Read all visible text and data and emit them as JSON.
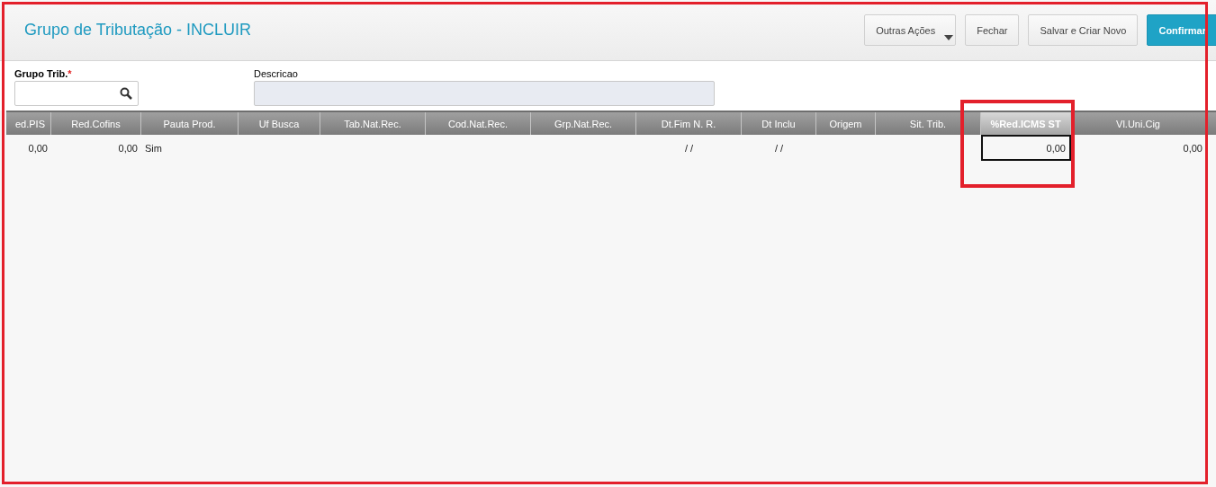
{
  "title": "Grupo de Tributação - INCLUIR",
  "actions": [
    {
      "label": "Outras Ações",
      "kind": "menu"
    },
    {
      "label": "Fechar",
      "kind": "plain"
    },
    {
      "label": "Salvar e Criar Novo",
      "kind": "plain"
    },
    {
      "label": "Confirmar",
      "kind": "primary"
    }
  ],
  "fields": [
    {
      "label": "Grupo Trib.",
      "required_mark": "*",
      "kind": "search"
    },
    {
      "label": "Descricao",
      "kind": "readonly"
    }
  ],
  "table": {
    "columns": [
      {
        "label": "ed.PIS",
        "selected": false
      },
      {
        "label": "Red.Cofins",
        "selected": false
      },
      {
        "label": "Pauta Prod.",
        "selected": false
      },
      {
        "label": "Uf Busca",
        "selected": false
      },
      {
        "label": "Tab.Nat.Rec.",
        "selected": false
      },
      {
        "label": "Cod.Nat.Rec.",
        "selected": false
      },
      {
        "label": "Grp.Nat.Rec.",
        "selected": false
      },
      {
        "label": "Dt.Fim N. R.",
        "selected": false
      },
      {
        "label": "Dt Inclu",
        "selected": false
      },
      {
        "label": "Origem",
        "selected": false
      },
      {
        "label": "Sit. Trib.",
        "selected": false
      },
      {
        "label": "%Red.ICMS ST",
        "selected": true
      },
      {
        "label": "Vl.Uni.Cig",
        "selected": false
      }
    ],
    "rows": [
      {
        "cells": [
          "0,00",
          "0,00",
          "Sim",
          "",
          "",
          "",
          "",
          "/ /",
          "/ /",
          "",
          "",
          "0,00",
          "0,00"
        ]
      }
    ]
  }
}
